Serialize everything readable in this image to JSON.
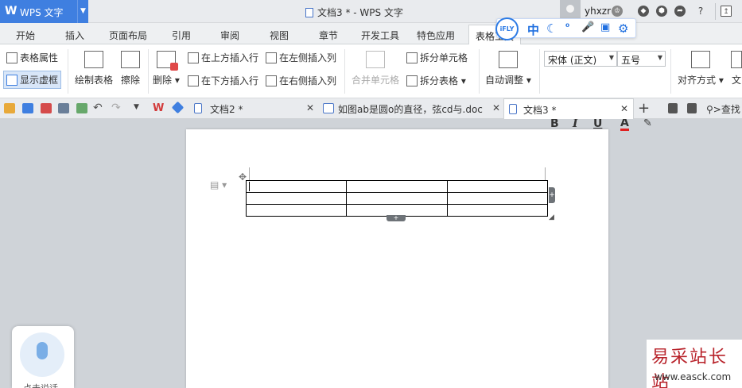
{
  "app": {
    "name": "WPS 文字",
    "logo": "W",
    "window_title": "文档3 * - WPS 文字",
    "user": "yhxzr"
  },
  "menu": {
    "items": [
      "开始",
      "插入",
      "页面布局",
      "引用",
      "审阅",
      "视图",
      "章节",
      "开发工具",
      "特色应用",
      "表格工具"
    ],
    "active": "表格工具"
  },
  "ifly": {
    "badge": "iFLY",
    "buttons": [
      "中",
      "☾",
      "⁰",
      "🎤",
      "▣",
      "⚙"
    ]
  },
  "ribbon": {
    "table_props": "表格属性",
    "show_grid": "显示虚框",
    "draw_table": "绘制表格",
    "erase": "擦除",
    "delete": "删除",
    "insert_row_above": "在上方插入行",
    "insert_row_below": "在下方插入行",
    "insert_col_left": "在左侧插入列",
    "insert_col_right": "在右侧插入列",
    "merge_cells": "合并单元格",
    "split_cells": "拆分单元格",
    "split_table": "拆分表格",
    "auto_adjust": "自动调整",
    "font_name": "宋体 (正文)",
    "font_size": "五号",
    "bold": "B",
    "italic": "I",
    "underline": "U",
    "font_color": "A",
    "align": "对齐方式",
    "text_dir": "文"
  },
  "tabs": {
    "items": [
      {
        "label": "文档2 *"
      },
      {
        "label": "如图ab是圆o的直径，弦cd与.doc"
      },
      {
        "label": "文档3 *"
      }
    ],
    "add": "+",
    "search": ">查找"
  },
  "voice": {
    "label": "点击说话"
  },
  "watermark": {
    "line1": "易采站长站",
    "line2": "www.easck.com"
  },
  "colors": {
    "accent": "#3f7fe0",
    "watermark_red": "#b8222a"
  }
}
